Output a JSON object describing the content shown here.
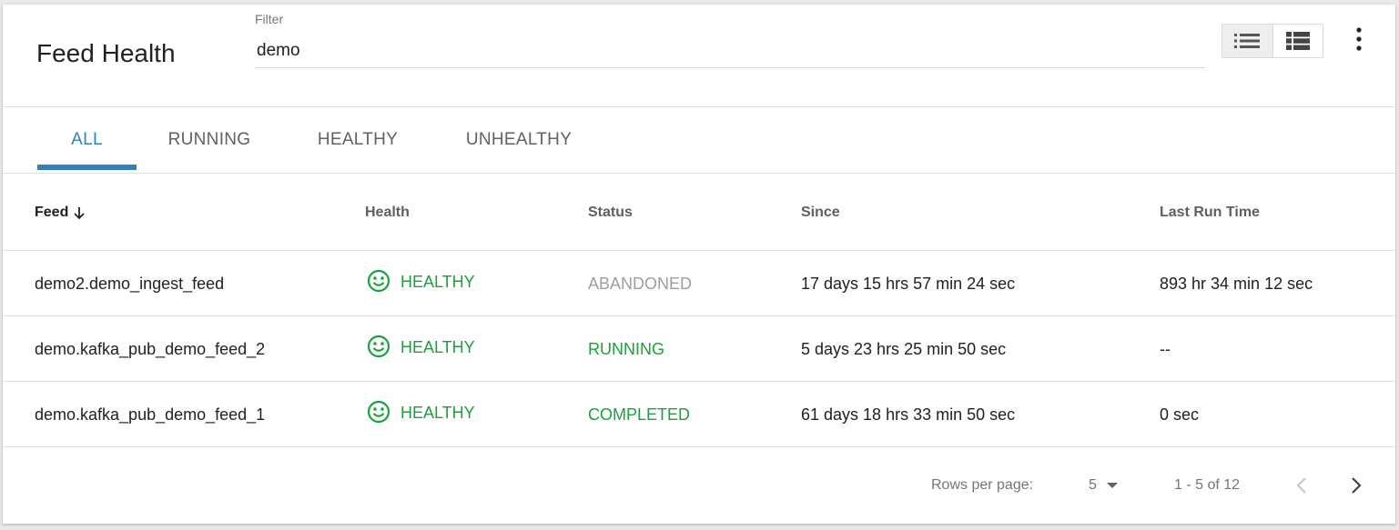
{
  "header": {
    "title": "Feed Health",
    "filter_label": "Filter",
    "filter_value": "demo"
  },
  "tabs": [
    {
      "label": "ALL",
      "active": true
    },
    {
      "label": "RUNNING",
      "active": false
    },
    {
      "label": "HEALTHY",
      "active": false
    },
    {
      "label": "UNHEALTHY",
      "active": false
    }
  ],
  "table": {
    "columns": [
      "Feed",
      "Health",
      "Status",
      "Since",
      "Last Run Time"
    ],
    "sort_column": "Feed",
    "sort_direction": "descending",
    "rows": [
      {
        "feed": "demo2.demo_ingest_feed",
        "health": "HEALTHY",
        "status": "ABANDONED",
        "since": "17 days 15 hrs 57 min 24 sec",
        "last_run": "893 hr 34 min 12 sec"
      },
      {
        "feed": "demo.kafka_pub_demo_feed_2",
        "health": "HEALTHY",
        "status": "RUNNING",
        "since": "5 days 23 hrs 25 min 50 sec",
        "last_run": "--"
      },
      {
        "feed": "demo.kafka_pub_demo_feed_1",
        "health": "HEALTHY",
        "status": "COMPLETED",
        "since": "61 days 18 hrs 33 min 50 sec",
        "last_run": "0 sec"
      }
    ]
  },
  "pagination": {
    "rows_per_page_label": "Rows per page:",
    "rows_per_page_value": "5",
    "range": "1 - 5 of 12"
  },
  "icons": {
    "view_list": "list-view-icon",
    "view_compact": "table-view-icon",
    "more": "more-vert-icon",
    "sort": "arrow-down-icon",
    "health": "smiley-icon",
    "dropdown": "caret-down-icon",
    "prev": "chevron-left-icon",
    "next": "chevron-right-icon"
  },
  "colors": {
    "accent": "#2f7fc1",
    "healthy": "#1aa23a",
    "muted": "#9e9e9e"
  }
}
